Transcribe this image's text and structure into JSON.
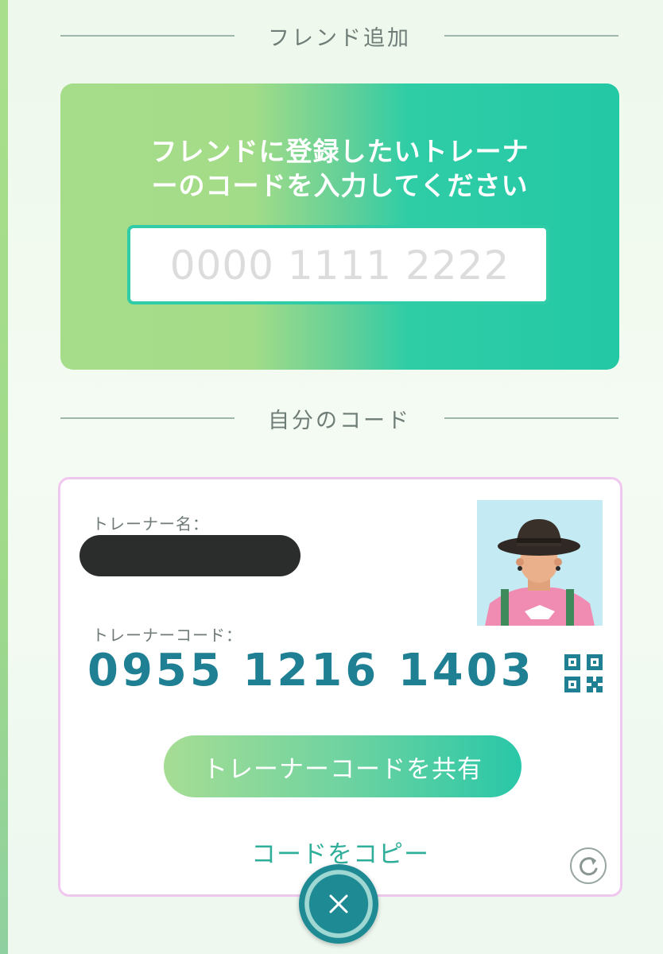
{
  "friend_add": {
    "header": "フレンド追加",
    "instructions_line1": "フレンドに登録したいトレーナ",
    "instructions_line2": "ーのコードを入力してください",
    "code_input": {
      "placeholder": "0000 1111 2222",
      "value": ""
    }
  },
  "my_code": {
    "header": "自分のコード",
    "name_label": "トレーナー名：",
    "code_label": "トレーナーコード：",
    "trainer_code": "0955 1216 1403",
    "share_button": "トレーナーコードを共有",
    "copy_link": "コードをコピー"
  },
  "icons": {
    "qr": "qr-code-icon",
    "refresh": "refresh-icon",
    "close": "close-icon"
  },
  "colors": {
    "accent_teal": "#1f7f93",
    "panel_green": "#a6dd8a",
    "panel_teal": "#23c8a5",
    "card_border": "#f0c7ee",
    "copy_link": "#2fae9a"
  }
}
